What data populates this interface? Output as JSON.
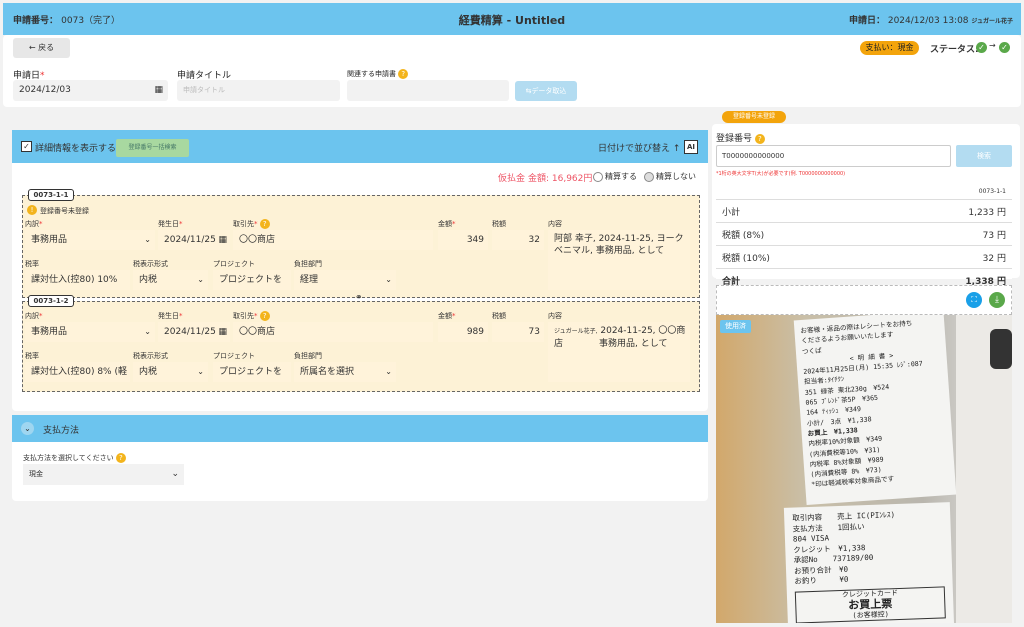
{
  "header": {
    "request_no_label": "申請番号：",
    "request_no": "0073（完了）",
    "title": "経費精算 - Untitled",
    "date_label": "申請日：",
    "date_value": "2024/12/03 13:08",
    "user": "ジュガール花子"
  },
  "toolbar": {
    "back": "戻る",
    "payment_badge": "支払い：現金",
    "status_label": "ステータス:",
    "status_arrow": "→"
  },
  "form": {
    "date_label": "申請日",
    "date_value": "2024/12/03",
    "title_label": "申請タイトル",
    "title_placeholder": "申請タイトル",
    "related_label": "関連する申請書",
    "import_button": "データ取込"
  },
  "details": {
    "toggle_label": "詳細情報を表示する",
    "reg_button": "登録番号一括検索",
    "sort_label": "日付けで並び替え ↑",
    "ai_label": "AI",
    "summary_prefix": "仮払金",
    "summary_amount": "金額: 16,962円",
    "opt1": "精算する",
    "opt2": "精算しない",
    "required_mark": "*"
  },
  "labels": {
    "category": "内訳",
    "date": "発生日",
    "vendor": "取引先",
    "amount": "金額",
    "tax": "税額",
    "content": "内容",
    "tax_rate": "税率",
    "tax_type": "税表示形式",
    "project": "プロジェクト",
    "dept": "負担部門",
    "unregistered": "登録番号未登録"
  },
  "items": [
    {
      "tag": "0073-1-1",
      "category": "事務用品",
      "date": "2024/11/25",
      "vendor": "〇〇商店",
      "amount": "349",
      "tax": "32",
      "content": "阿部 幸子, 2024-11-25, ヨークベニマル, 事務用品, として",
      "tax_rate": "課対仕入(控80) 10%",
      "tax_type": "内税",
      "project": "プロジェクトを",
      "dept": "経理"
    },
    {
      "tag": "0073-1-2",
      "category": "事務用品",
      "date": "2024/11/25",
      "vendor": "〇〇商店",
      "amount": "989",
      "tax": "73",
      "content_small": "ジュガール花子,",
      "content": "2024-11-25, 〇〇商店　　　　事務用品, として",
      "tax_rate": "課対仕入(控80) 8% (軽",
      "tax_type": "内税",
      "project": "プロジェクトを",
      "dept": "所属名を選択"
    }
  ],
  "payment": {
    "section_title": "支払方法",
    "prompt": "支払方法を選択してください",
    "value": "現金"
  },
  "right": {
    "unreg_badge": "登録番号未登録",
    "reg_label": "登録番号",
    "reg_value": "T0000000000000",
    "search": "検索",
    "error": "*1桁の英大文字T(大)が必要です(例. T0000000000000)",
    "tot_header": "0073-1-1",
    "rows": [
      {
        "label": "小計",
        "value": "1,233 円"
      },
      {
        "label": "税額 (8%)",
        "value": "73 円"
      },
      {
        "label": "税額 (10%)",
        "value": "32 円"
      },
      {
        "label": "合計",
        "value": "1,338 円"
      }
    ],
    "used_badge": "使用済"
  },
  "receipt": {
    "lines": [
      "お客様・返品の際はレシートをお持ち",
      "くださるようお願いいたします",
      "つくば",
      "< 明 細 書 >",
      "2024年11月25日(月) 15:35 ﾚｼﾞ:087",
      "担当者:ﾀｲﾁｸﾝ",
      "351 緑茶 東北230g　¥524",
      "065 ﾌﾞﾚﾝﾄﾞ茶5P　¥365",
      "164 ﾃｨｯｼｭ　¥349",
      "小計/　3点　¥1,338",
      "お買上　¥1,338",
      "内税率10%対象額　¥349",
      "(内消費税等10%　¥31)",
      "内税率 8%対象額　¥989",
      "(内消費税等 8%　¥73)",
      "*印は軽減税率対象商品です"
    ],
    "lines2": [
      "取引内容　　売上 IC(PIﾝﾚｽ)",
      "支払方法　　1回払い",
      "804 VISA",
      "クレジット　¥1,338",
      "承認No　　737189/00",
      "お預り合計　¥0",
      "お釣り　　　¥0"
    ],
    "card": "クレジットカード",
    "sale": "お買上票",
    "copy": "(お客様控)"
  }
}
